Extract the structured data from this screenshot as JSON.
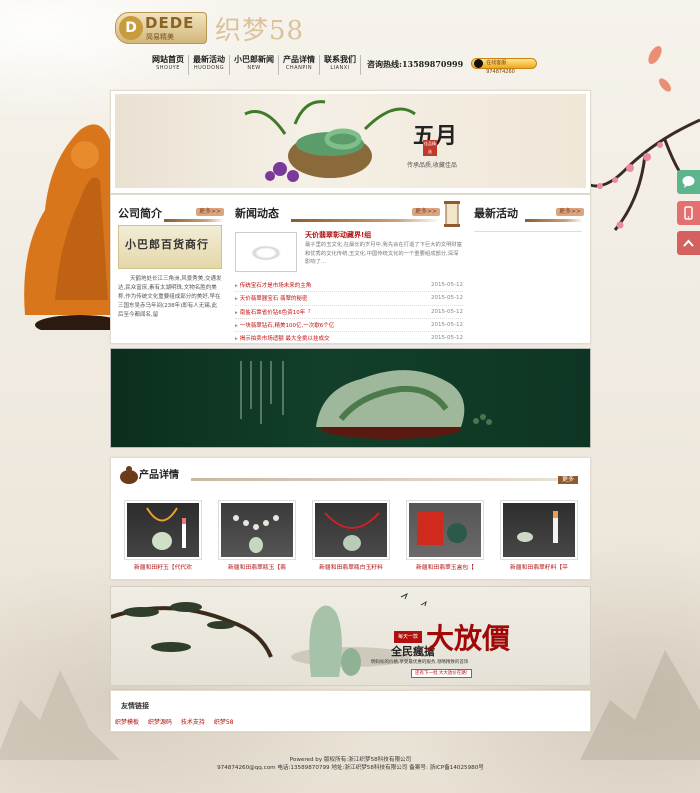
{
  "header": {
    "logo_en": "DEDE",
    "logo_sub": "简易精美",
    "logo_cn": "织梦58",
    "nav": [
      {
        "zh": "网站首页",
        "en": "SHOUYE"
      },
      {
        "zh": "最新活动",
        "en": "HUODONG"
      },
      {
        "zh": "小巴郎新闻",
        "en": "NEW"
      },
      {
        "zh": "产品详情",
        "en": "CHANPIN"
      },
      {
        "zh": "联系我们",
        "en": "LIANXI"
      }
    ],
    "hotline": "咨询热线:13589870999",
    "qq": "在线客服 974874260"
  },
  "banner": {
    "month": "五月",
    "caption": "传承品质,收藏佳品",
    "seal": "佳品精选"
  },
  "about": {
    "title": "公司简介",
    "more": "更多>>",
    "calligraphy": "小巴郎百货商行",
    "text": "天鹤地处长江三角洲,风景秀美,交通发达,民众富庶,素有太湖明珠,文物名胜的美称,作为传统文化重要组成部分的美好,早在三国东吴赤乌年间(238年)即有人无锡,此后至今都闻名,留"
  },
  "news": {
    "title": "新闻动态",
    "more": "更多>>",
    "feature_title": "天价翡翠彰动藏界!组",
    "feature_desc": "最子里的玉文化,在最长的岁月中,我先会在打造了下巨大的文明财富和优秀的文化传统,玉文化,中国传统文化的一个重要组成部分,深深影响了...",
    "items": [
      {
        "title": "传统宝石才是市场未来的主角",
        "date": "2015-05-12"
      },
      {
        "title": "天价翡翠器宝石 翡翠的秘密",
        "date": "2015-05-12"
      },
      {
        "title": "南盐石覃省价钻6色资10年「",
        ",": "",
        "date": "2015-05-12"
      },
      {
        "title": "一块翡翠钻石,精美100亿,一次歇6个亿",
        "date": "2015-05-12"
      },
      {
        "title": "揭示拍卖市场适额 最大全挑以挂成交",
        "date": "2015-05-12"
      }
    ]
  },
  "latest": {
    "title": "最新活动",
    "more": "更多>>"
  },
  "products": {
    "title": "产品详情",
    "more": "更多",
    "items": [
      {
        "name": "新疆和田籽玉【代代欢"
      },
      {
        "name": "新疆和田翡翠瓶玉【翡"
      },
      {
        "name": "新疆和田翡翠瓶白玉籽料"
      },
      {
        "name": "新疆和田翡翠玉盒包【"
      },
      {
        "name": "新疆和田翡翠籽料【平"
      }
    ]
  },
  "ad2": {
    "big": "大放價",
    "slogan": "全民瘋搶",
    "tag": "每天一款",
    "sub": "明码标的价格,享受最优惠的服务,领略精致的首饰",
    "btn": "还有下一批 大大放价在路!"
  },
  "links": {
    "title": "友情链接",
    "items": [
      "织梦模板",
      "织梦源码",
      "技术支持",
      "织梦58"
    ]
  },
  "footer": {
    "line1": "Powered by    版权所有:浙江织梦58科技有限公司",
    "line2": "974874260@qq.com  电话:13589870799  地址:浙江织梦58科技有限公司  备案号: 浙ICP备14025980号"
  },
  "colors": {
    "accent": "#b01010",
    "brown": "#8d5b2d",
    "chat": "#5db58b",
    "phone": "#e46f6f"
  }
}
